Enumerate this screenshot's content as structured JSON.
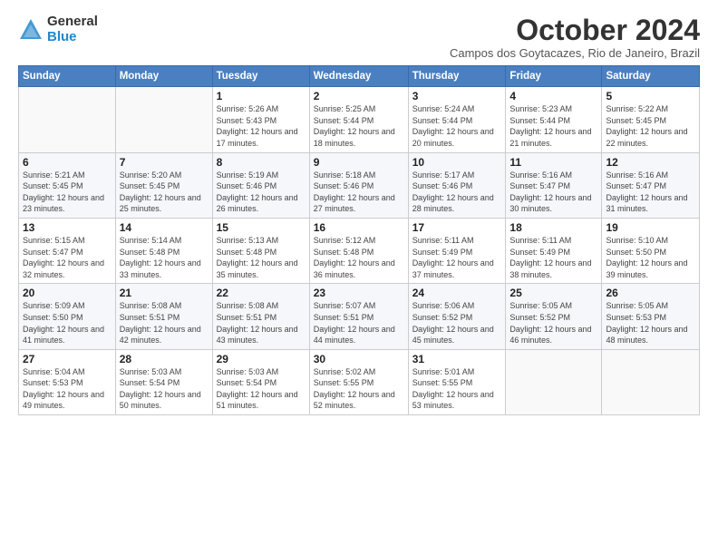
{
  "logo": {
    "general": "General",
    "blue": "Blue"
  },
  "title": "October 2024",
  "subtitle": "Campos dos Goytacazes, Rio de Janeiro, Brazil",
  "headers": [
    "Sunday",
    "Monday",
    "Tuesday",
    "Wednesday",
    "Thursday",
    "Friday",
    "Saturday"
  ],
  "weeks": [
    [
      {
        "day": "",
        "info": ""
      },
      {
        "day": "",
        "info": ""
      },
      {
        "day": "1",
        "info": "Sunrise: 5:26 AM\nSunset: 5:43 PM\nDaylight: 12 hours and 17 minutes."
      },
      {
        "day": "2",
        "info": "Sunrise: 5:25 AM\nSunset: 5:44 PM\nDaylight: 12 hours and 18 minutes."
      },
      {
        "day": "3",
        "info": "Sunrise: 5:24 AM\nSunset: 5:44 PM\nDaylight: 12 hours and 20 minutes."
      },
      {
        "day": "4",
        "info": "Sunrise: 5:23 AM\nSunset: 5:44 PM\nDaylight: 12 hours and 21 minutes."
      },
      {
        "day": "5",
        "info": "Sunrise: 5:22 AM\nSunset: 5:45 PM\nDaylight: 12 hours and 22 minutes."
      }
    ],
    [
      {
        "day": "6",
        "info": "Sunrise: 5:21 AM\nSunset: 5:45 PM\nDaylight: 12 hours and 23 minutes."
      },
      {
        "day": "7",
        "info": "Sunrise: 5:20 AM\nSunset: 5:45 PM\nDaylight: 12 hours and 25 minutes."
      },
      {
        "day": "8",
        "info": "Sunrise: 5:19 AM\nSunset: 5:46 PM\nDaylight: 12 hours and 26 minutes."
      },
      {
        "day": "9",
        "info": "Sunrise: 5:18 AM\nSunset: 5:46 PM\nDaylight: 12 hours and 27 minutes."
      },
      {
        "day": "10",
        "info": "Sunrise: 5:17 AM\nSunset: 5:46 PM\nDaylight: 12 hours and 28 minutes."
      },
      {
        "day": "11",
        "info": "Sunrise: 5:16 AM\nSunset: 5:47 PM\nDaylight: 12 hours and 30 minutes."
      },
      {
        "day": "12",
        "info": "Sunrise: 5:16 AM\nSunset: 5:47 PM\nDaylight: 12 hours and 31 minutes."
      }
    ],
    [
      {
        "day": "13",
        "info": "Sunrise: 5:15 AM\nSunset: 5:47 PM\nDaylight: 12 hours and 32 minutes."
      },
      {
        "day": "14",
        "info": "Sunrise: 5:14 AM\nSunset: 5:48 PM\nDaylight: 12 hours and 33 minutes."
      },
      {
        "day": "15",
        "info": "Sunrise: 5:13 AM\nSunset: 5:48 PM\nDaylight: 12 hours and 35 minutes."
      },
      {
        "day": "16",
        "info": "Sunrise: 5:12 AM\nSunset: 5:48 PM\nDaylight: 12 hours and 36 minutes."
      },
      {
        "day": "17",
        "info": "Sunrise: 5:11 AM\nSunset: 5:49 PM\nDaylight: 12 hours and 37 minutes."
      },
      {
        "day": "18",
        "info": "Sunrise: 5:11 AM\nSunset: 5:49 PM\nDaylight: 12 hours and 38 minutes."
      },
      {
        "day": "19",
        "info": "Sunrise: 5:10 AM\nSunset: 5:50 PM\nDaylight: 12 hours and 39 minutes."
      }
    ],
    [
      {
        "day": "20",
        "info": "Sunrise: 5:09 AM\nSunset: 5:50 PM\nDaylight: 12 hours and 41 minutes."
      },
      {
        "day": "21",
        "info": "Sunrise: 5:08 AM\nSunset: 5:51 PM\nDaylight: 12 hours and 42 minutes."
      },
      {
        "day": "22",
        "info": "Sunrise: 5:08 AM\nSunset: 5:51 PM\nDaylight: 12 hours and 43 minutes."
      },
      {
        "day": "23",
        "info": "Sunrise: 5:07 AM\nSunset: 5:51 PM\nDaylight: 12 hours and 44 minutes."
      },
      {
        "day": "24",
        "info": "Sunrise: 5:06 AM\nSunset: 5:52 PM\nDaylight: 12 hours and 45 minutes."
      },
      {
        "day": "25",
        "info": "Sunrise: 5:05 AM\nSunset: 5:52 PM\nDaylight: 12 hours and 46 minutes."
      },
      {
        "day": "26",
        "info": "Sunrise: 5:05 AM\nSunset: 5:53 PM\nDaylight: 12 hours and 48 minutes."
      }
    ],
    [
      {
        "day": "27",
        "info": "Sunrise: 5:04 AM\nSunset: 5:53 PM\nDaylight: 12 hours and 49 minutes."
      },
      {
        "day": "28",
        "info": "Sunrise: 5:03 AM\nSunset: 5:54 PM\nDaylight: 12 hours and 50 minutes."
      },
      {
        "day": "29",
        "info": "Sunrise: 5:03 AM\nSunset: 5:54 PM\nDaylight: 12 hours and 51 minutes."
      },
      {
        "day": "30",
        "info": "Sunrise: 5:02 AM\nSunset: 5:55 PM\nDaylight: 12 hours and 52 minutes."
      },
      {
        "day": "31",
        "info": "Sunrise: 5:01 AM\nSunset: 5:55 PM\nDaylight: 12 hours and 53 minutes."
      },
      {
        "day": "",
        "info": ""
      },
      {
        "day": "",
        "info": ""
      }
    ]
  ]
}
